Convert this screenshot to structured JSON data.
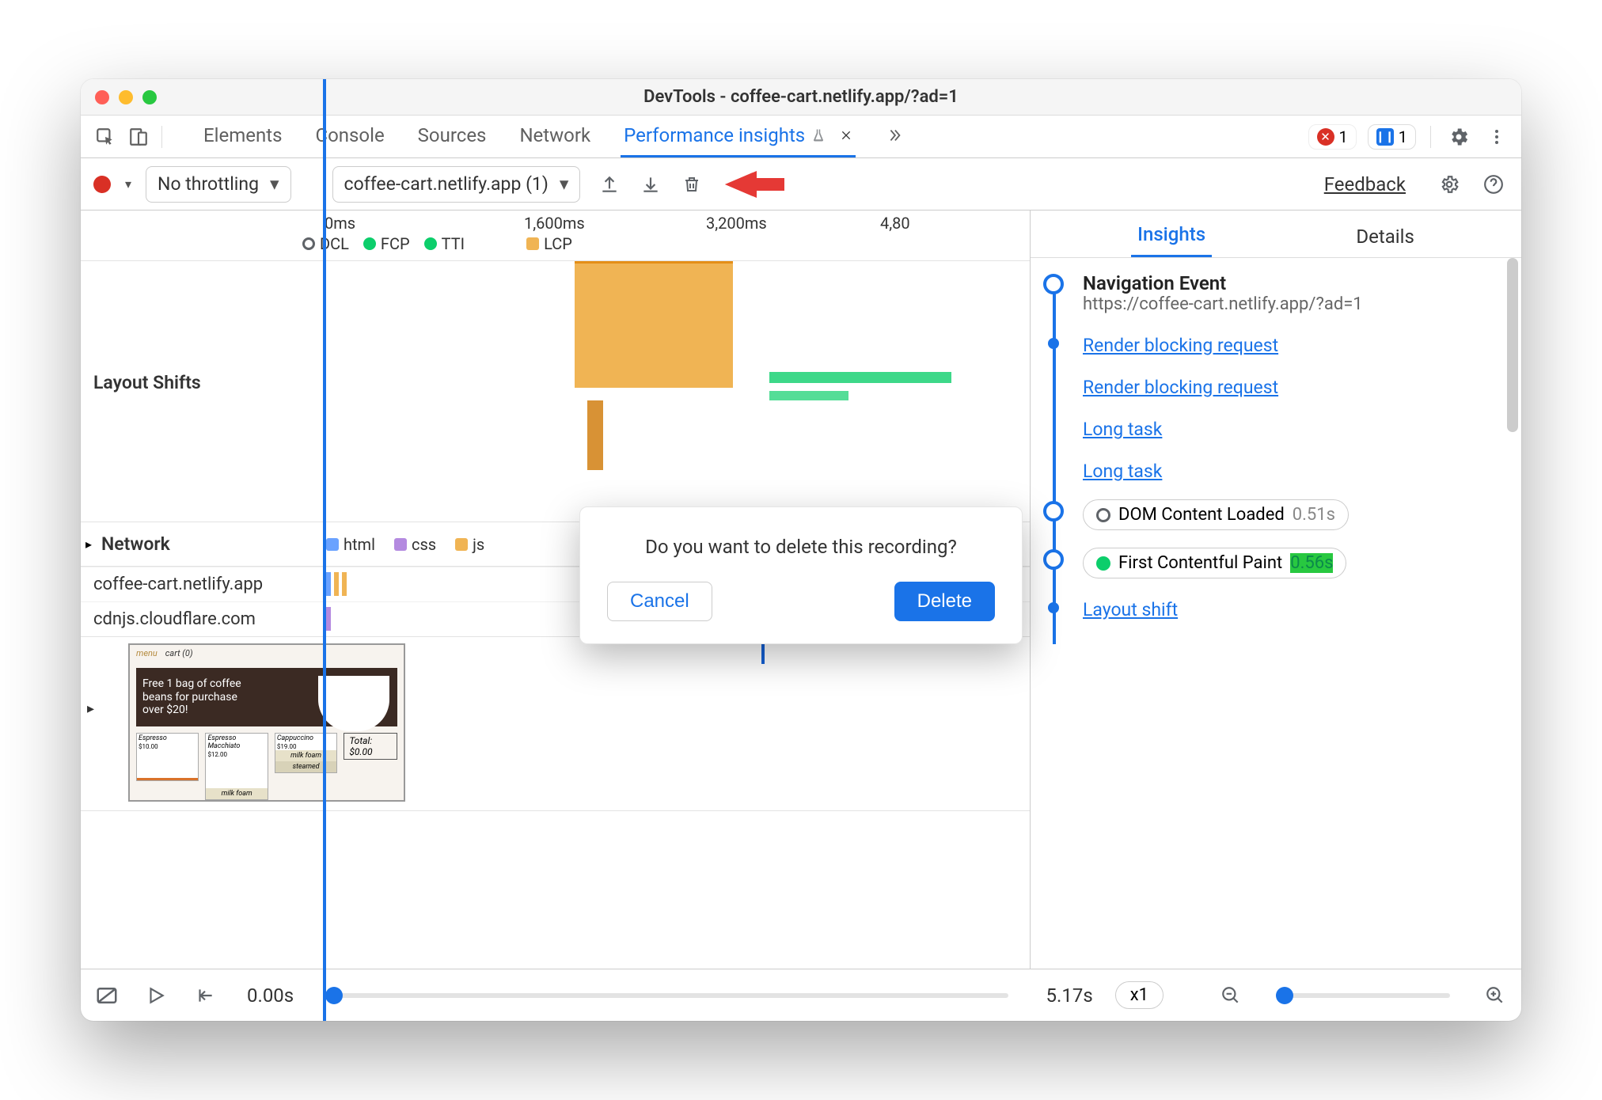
{
  "window": {
    "title": "DevTools - coffee-cart.netlify.app/?ad=1"
  },
  "tabs": {
    "panels": [
      "Elements",
      "Console",
      "Sources",
      "Network"
    ],
    "active": "Performance insights",
    "errors_count": "1",
    "messages_count": "1"
  },
  "toolbar": {
    "throttling": "No throttling",
    "recording_name": "coffee-cart.netlify.app (1)",
    "feedback": "Feedback"
  },
  "ruler": {
    "t0": "0ms",
    "t1": "1,600ms",
    "t2": "3,200ms",
    "t3": "4,80",
    "legend": {
      "dcl": "DCL",
      "fcp": "FCP",
      "tti": "TTI",
      "lcp": "LCP"
    }
  },
  "lanes": {
    "layout_shifts_label": "Layout Shifts",
    "network_label": "Network",
    "net_legend": {
      "html": "html",
      "css": "css",
      "js": "js"
    },
    "hosts": [
      "coffee-cart.netlify.app",
      "cdnjs.cloudflare.com"
    ]
  },
  "thumb": {
    "promo": "Free 1 bag of coffee beans for purchase over $20!",
    "menu_label": "menu",
    "cart_label": "cart (0)",
    "items": [
      "Espresso",
      "Espresso Macchiato",
      "Cappuccino"
    ],
    "prices": [
      "$10.00",
      "$12.00",
      "$19.00"
    ],
    "milk_foam": "milk foam",
    "steamed": "steamed",
    "total": "Total: $0.00"
  },
  "player": {
    "start": "0.00s",
    "end": "5.17s",
    "speed": "x1"
  },
  "insights": {
    "tabs": {
      "insights": "Insights",
      "details": "Details"
    },
    "nav_title": "Navigation Event",
    "nav_url": "https://coffee-cart.netlify.app/?ad=1",
    "rbr": "Render blocking request",
    "long_task": "Long task",
    "dcl_chip": "DOM Content Loaded",
    "dcl_time": "0.51s",
    "fcp_chip": "First Contentful Paint",
    "fcp_time": "0.56s",
    "layout_shift": "Layout shift"
  },
  "dialog": {
    "message": "Do you want to delete this recording?",
    "cancel": "Cancel",
    "delete": "Delete"
  }
}
